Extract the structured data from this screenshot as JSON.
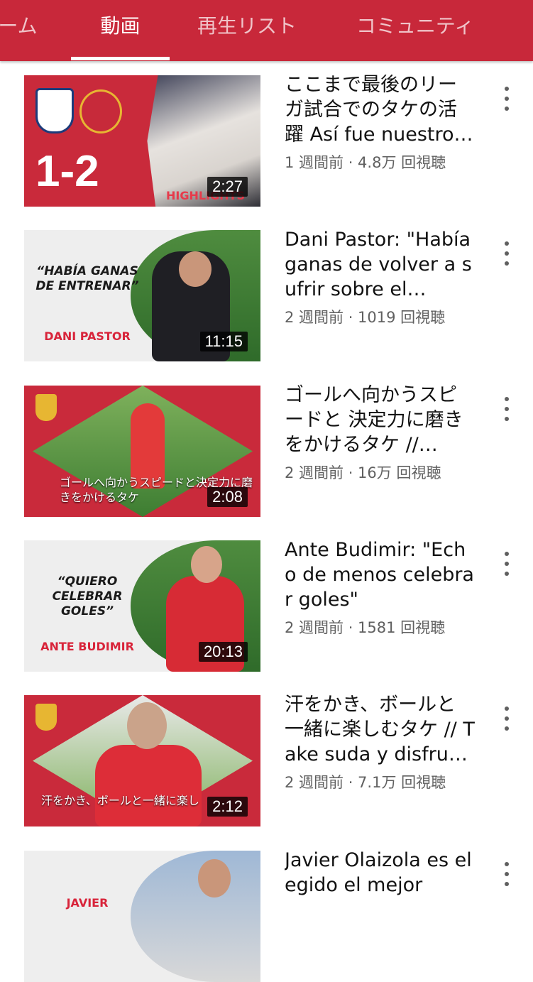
{
  "tabs": [
    {
      "label": "ーム",
      "active": false
    },
    {
      "label": "動画",
      "active": true
    },
    {
      "label": "再生リスト",
      "active": false
    },
    {
      "label": "コミュニティ",
      "active": false
    }
  ],
  "videos": [
    {
      "title": "ここまで最後のリーガ試合でのタケの活躍 Así fue nuestro…",
      "meta": "1 週間前 · 4.8万 回視聴",
      "duration": "2:27",
      "thumb": {
        "score": "1-2",
        "badge": "HIGHLIGHTS"
      }
    },
    {
      "title": "Dani Pastor: \"Había ganas de volver a sufrir sobre el…",
      "meta": "2 週間前 · 1019 回視聴",
      "duration": "11:15",
      "thumb": {
        "quote": "“HABÍA GANAS DE ENTRENAR”",
        "name": "DANI PASTOR"
      }
    },
    {
      "title": "ゴールへ向かうスピードと 決定力に磨きをかけるタケ //…",
      "meta": "2 週間前 · 16万 回視聴",
      "duration": "2:08",
      "thumb": {
        "caption": "ゴールへ向かうスピードと決定力に磨きをかけるタケ"
      }
    },
    {
      "title": "Ante Budimir: \"Echo de menos celebrar goles\"",
      "meta": "2 週間前 · 1581 回視聴",
      "duration": "20:13",
      "thumb": {
        "quote": "“QUIERO CELEBRAR GOLES”",
        "name": "ANTE BUDIMIR"
      }
    },
    {
      "title": "汗をかき、ボールと一緒に楽しむタケ // Take suda y disfrut…",
      "meta": "2 週間前 · 7.1万 回視聴",
      "duration": "2:12",
      "thumb": {
        "caption": "汗をかき、ボールと一緒に楽し"
      }
    },
    {
      "title": "Javier Olaizola es elegido el mejor",
      "meta": "",
      "duration": "",
      "thumb": {
        "name": "JAVIER"
      }
    }
  ],
  "colors": {
    "brand_red": "#c8283a",
    "text": "#121212",
    "secondary": "#606060"
  }
}
